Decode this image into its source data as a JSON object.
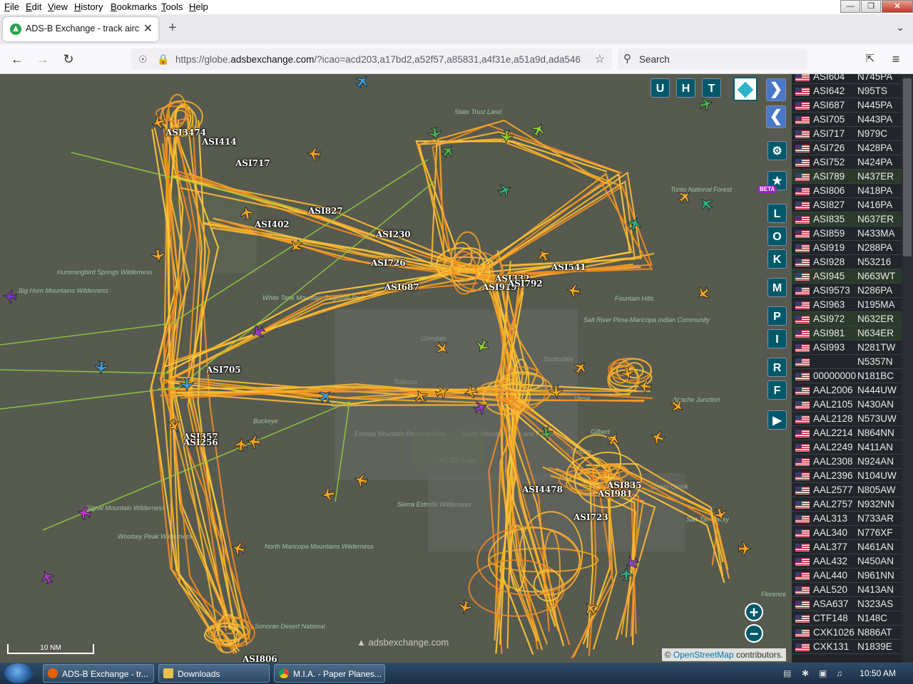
{
  "menubar": {
    "items": [
      "File",
      "Edit",
      "View",
      "History",
      "Bookmarks",
      "Tools",
      "Help"
    ],
    "underline": [
      "F",
      "E",
      "V",
      "H",
      "B",
      "T",
      "H"
    ]
  },
  "tab": {
    "title": "ADS-B Exchange - track aircraft"
  },
  "navbar": {
    "url_prefix": "https://globe.",
    "url_domain": "adsbexchange.com",
    "url_rest": "/?icao=acd203,a17bd2,a52f57,a85831,a4f31e,a51a9d,ada546",
    "search_label": "Search"
  },
  "map": {
    "buttons_top": [
      "U",
      "H",
      "T"
    ],
    "buttons_side": [
      "L",
      "O",
      "K",
      "M",
      "P",
      "I",
      "R",
      "F"
    ],
    "beta_badge": "BETA",
    "scale_label": "10 NM",
    "attribution_prefix": "©",
    "attribution_link": "OpenStreetMap",
    "attribution_suffix": "contributors.",
    "watermark": "adsbexchange.com",
    "place_labels": [
      {
        "text": "Tonto National Forest"
      },
      {
        "text": "Fountain Hills"
      },
      {
        "text": "Scottsdale"
      },
      {
        "text": "Mesa"
      },
      {
        "text": "Tempe"
      },
      {
        "text": "Chandler"
      },
      {
        "text": "Gilbert"
      },
      {
        "text": "Queen Creek"
      },
      {
        "text": "San Tan Valley"
      },
      {
        "text": "Apache Junction"
      },
      {
        "text": "Florence"
      },
      {
        "text": "Buckeye"
      },
      {
        "text": "Goodyear"
      },
      {
        "text": "Tolleson"
      },
      {
        "text": "Glendale"
      },
      {
        "text": "Estrella Mountain Regional Park"
      },
      {
        "text": "South Mountain Park and Preserve"
      },
      {
        "text": "AZ 202 Loop"
      },
      {
        "text": "Sierra Estrella Wilderness"
      },
      {
        "text": "North Maricopa Mountains Wilderness"
      },
      {
        "text": "Woolsey Peak Wilderness"
      },
      {
        "text": "Signal Mountain Wilderness"
      },
      {
        "text": "Hummingbird Springs Wilderness"
      },
      {
        "text": "Big Horn Mountains Wilderness"
      },
      {
        "text": "White Tank Mountain Regional Park"
      },
      {
        "text": "Sonoran Desert National"
      },
      {
        "text": "State Trust Land"
      },
      {
        "text": "Salt River Pima-Maricopa Indian Community"
      }
    ],
    "callsign_labels": [
      "ASI3474",
      "ASI414",
      "ASI717",
      "ASI827",
      "ASI402",
      "ASI230",
      "ASI726",
      "ASI687",
      "ASI541",
      "ASI332",
      "ASI919",
      "ASI792",
      "ASI705",
      "ASI357",
      "ASI256",
      "ASI4478",
      "ASI835",
      "ASI981",
      "ASI723",
      "ASI806"
    ]
  },
  "sidebar": {
    "rows": [
      {
        "callsign": "ASI604",
        "reg": "N745PA",
        "alt": false
      },
      {
        "callsign": "ASI642",
        "reg": "N95TS",
        "alt": false
      },
      {
        "callsign": "ASI687",
        "reg": "N445PA",
        "alt": false
      },
      {
        "callsign": "ASI705",
        "reg": "N443PA",
        "alt": false
      },
      {
        "callsign": "ASI717",
        "reg": "N979C",
        "alt": false
      },
      {
        "callsign": "ASI726",
        "reg": "N428PA",
        "alt": false
      },
      {
        "callsign": "ASI752",
        "reg": "N424PA",
        "alt": false
      },
      {
        "callsign": "ASI789",
        "reg": "N437ER",
        "alt": true
      },
      {
        "callsign": "ASI806",
        "reg": "N418PA",
        "alt": false
      },
      {
        "callsign": "ASI827",
        "reg": "N416PA",
        "alt": false
      },
      {
        "callsign": "ASI835",
        "reg": "N637ER",
        "alt": true
      },
      {
        "callsign": "ASI859",
        "reg": "N433MA",
        "alt": false
      },
      {
        "callsign": "ASI919",
        "reg": "N288PA",
        "alt": false
      },
      {
        "callsign": "ASI928",
        "reg": "N53216",
        "alt": false
      },
      {
        "callsign": "ASI945",
        "reg": "N663WT",
        "alt": true
      },
      {
        "callsign": "ASI9573",
        "reg": "N286PA",
        "alt": false
      },
      {
        "callsign": "ASI963",
        "reg": "N195MA",
        "alt": false
      },
      {
        "callsign": "ASI972",
        "reg": "N632ER",
        "alt": true
      },
      {
        "callsign": "ASI981",
        "reg": "N634ER",
        "alt": true
      },
      {
        "callsign": "ASI993",
        "reg": "N281TW",
        "alt": false
      },
      {
        "callsign": "",
        "reg": "N5357N",
        "alt": false
      },
      {
        "callsign": "00000000",
        "reg": "N181BC",
        "alt": false
      },
      {
        "callsign": "AAL2006",
        "reg": "N444UW",
        "alt": false
      },
      {
        "callsign": "AAL2105",
        "reg": "N430AN",
        "alt": false
      },
      {
        "callsign": "AAL2128",
        "reg": "N573UW",
        "alt": false
      },
      {
        "callsign": "AAL2214",
        "reg": "N864NN",
        "alt": false
      },
      {
        "callsign": "AAL2249",
        "reg": "N411AN",
        "alt": false
      },
      {
        "callsign": "AAL2308",
        "reg": "N924AN",
        "alt": false
      },
      {
        "callsign": "AAL2396",
        "reg": "N104UW",
        "alt": false
      },
      {
        "callsign": "AAL2577",
        "reg": "N805AW",
        "alt": false
      },
      {
        "callsign": "AAL2757",
        "reg": "N932NN",
        "alt": false
      },
      {
        "callsign": "AAL313",
        "reg": "N733AR",
        "alt": false
      },
      {
        "callsign": "AAL340",
        "reg": "N776XF",
        "alt": false
      },
      {
        "callsign": "AAL377",
        "reg": "N461AN",
        "alt": false
      },
      {
        "callsign": "AAL432",
        "reg": "N450AN",
        "alt": false
      },
      {
        "callsign": "AAL440",
        "reg": "N961NN",
        "alt": false
      },
      {
        "callsign": "AAL520",
        "reg": "N413AN",
        "alt": false
      },
      {
        "callsign": "ASA637",
        "reg": "N323AS",
        "alt": false
      },
      {
        "callsign": "CTF148",
        "reg": "N148C",
        "alt": false
      },
      {
        "callsign": "CXK1026",
        "reg": "N886AT",
        "alt": false
      },
      {
        "callsign": "CXK131",
        "reg": "N1839E",
        "alt": false
      }
    ]
  },
  "taskbar": {
    "tasks": [
      "ADS-B Exchange - tr...",
      "Downloads",
      "M.I.A. - Paper Planes..."
    ],
    "clock": "10:50 AM"
  },
  "colors": {
    "track": "#f5a623",
    "track_alt": "#ffc83a",
    "map_bg": "#565a4f",
    "ui_accent": "#00596b"
  }
}
